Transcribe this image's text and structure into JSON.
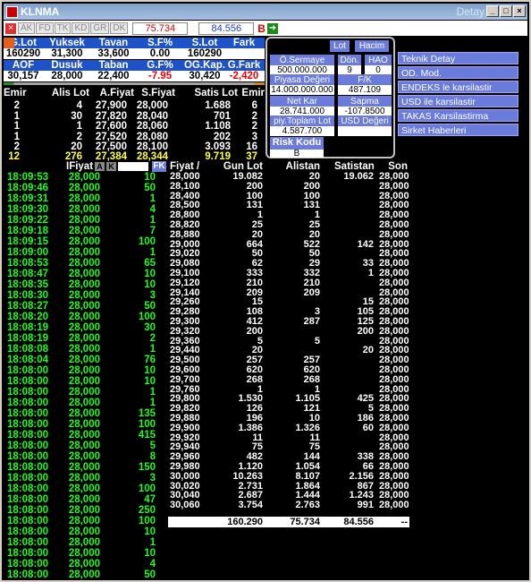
{
  "window": {
    "title": "KLNMA",
    "right_title": "Detay",
    "buttons": [
      "_",
      "□",
      "×"
    ]
  },
  "toolbar": {
    "tabs": [
      "AK",
      "FD",
      "TK",
      "KD",
      "GR",
      "DK"
    ],
    "price": "75.734",
    "price2": "84.556",
    "b_label": "B"
  },
  "summary": {
    "h1": [
      "G.Lot",
      "Yuksek",
      "Tavan",
      "S.F%",
      "S.Lot",
      "Fark"
    ],
    "v1": [
      "160290",
      "31,300",
      "33,600",
      "0.00",
      "160290",
      ""
    ],
    "h2": [
      "AOF",
      "Dusuk",
      "Taban",
      "G.F%",
      "OG.Kap.",
      "G.Fark"
    ],
    "v2": [
      "30,157",
      "28,000",
      "22,400",
      "-7.95",
      "30,420",
      "-2,420"
    ]
  },
  "depth": {
    "headers": [
      "Emir",
      "Alis Lot",
      "A.Fiyat",
      "S.Fiyat",
      "Satis Lot",
      "Emir"
    ],
    "rows": [
      [
        "2",
        "4",
        "27,900",
        "28,000",
        "1.688",
        "6"
      ],
      [
        "1",
        "30",
        "27,820",
        "28,040",
        "701",
        "2"
      ],
      [
        "1",
        "1",
        "27,600",
        "28,060",
        "1.108",
        "2"
      ],
      [
        "1",
        "2",
        "27,520",
        "28,080",
        "202",
        "3"
      ],
      [
        "2",
        "20",
        "27,500",
        "28,100",
        "3.093",
        "16"
      ]
    ],
    "total": [
      "12",
      "276",
      "27,384",
      "28,344",
      "9.719",
      "37"
    ]
  },
  "panel": {
    "lot": "Lot",
    "hacim": "Hacim",
    "o_sermaye": "Ö.Sermaye",
    "o_sermaye_v": "500.000.000",
    "don": "Dön.",
    "don_v": "9",
    "hao": "HAO",
    "hao_v": "0",
    "piyasa": "Piyasa Değeri",
    "piyasa_v": "14.000.000.000",
    "fk": "F/K",
    "fk_v": "487.109",
    "netkar": "Net Kar",
    "netkar_v": "28.741.000",
    "sapma": "Sapma",
    "sapma_v": "-107.8500",
    "ptoplam": "piy.Toplam Lot",
    "ptoplam_v": "4.587.700",
    "usd": "USD Değeri",
    "usd_v": "",
    "risk": "Risk Kodu",
    "risk_v": "B"
  },
  "side_menu": [
    "Teknik Detay",
    "OD. Mod.",
    "ENDEKS le karsilastir",
    "USD ile karsilastir",
    "TAKAS Karsilastirma",
    "Sirket Haberleri"
  ],
  "trades": {
    "header": "IFiyat",
    "a": "A",
    "k": "K",
    "fk": "FK",
    "rows": [
      [
        "18:09:53",
        "28,000",
        "10"
      ],
      [
        "18:09:46",
        "28,000",
        "50"
      ],
      [
        "18:09:31",
        "28,000",
        "1"
      ],
      [
        "18:09:30",
        "28,000",
        "4"
      ],
      [
        "18:09:22",
        "28,000",
        "1"
      ],
      [
        "18:09:18",
        "28,000",
        "7"
      ],
      [
        "18:09:15",
        "28,000",
        "100"
      ],
      [
        "18:09:00",
        "28,000",
        "1"
      ],
      [
        "18:08:53",
        "28,000",
        "65"
      ],
      [
        "18:08:47",
        "28,000",
        "10"
      ],
      [
        "18:08:35",
        "28,000",
        "10"
      ],
      [
        "18:08:30",
        "28,000",
        "3"
      ],
      [
        "18:08:27",
        "28,000",
        "50"
      ],
      [
        "18:08:20",
        "28,000",
        "100"
      ],
      [
        "18:08:19",
        "28,000",
        "30"
      ],
      [
        "18:08:19",
        "28,000",
        "2"
      ],
      [
        "18:08:08",
        "28,000",
        "1"
      ],
      [
        "18:08:04",
        "28,000",
        "76"
      ],
      [
        "18:08:00",
        "28,000",
        "10"
      ],
      [
        "18:08:00",
        "28,000",
        "10"
      ],
      [
        "18:08:00",
        "28,000",
        "1"
      ],
      [
        "18:08:00",
        "28,000",
        "1"
      ],
      [
        "18:08:00",
        "28,000",
        "135"
      ],
      [
        "18:08:00",
        "28,000",
        "100"
      ],
      [
        "18:08:00",
        "28,000",
        "415"
      ],
      [
        "18:08:00",
        "28,000",
        "5"
      ],
      [
        "18:08:00",
        "28,000",
        "8"
      ],
      [
        "18:08:00",
        "28,000",
        "150"
      ],
      [
        "18:08:00",
        "28,000",
        "3"
      ],
      [
        "18:08:00",
        "28,000",
        "100"
      ],
      [
        "18:08:00",
        "28,000",
        "47"
      ],
      [
        "18:08:00",
        "28,000",
        "250"
      ],
      [
        "18:08:00",
        "28,000",
        "100"
      ],
      [
        "18:08:00",
        "28,000",
        "10"
      ],
      [
        "18:08:00",
        "28,000",
        "1"
      ],
      [
        "18:08:00",
        "28,000",
        "10"
      ],
      [
        "18:08:00",
        "28,000",
        "4"
      ],
      [
        "18:08:00",
        "28,000",
        "50"
      ]
    ]
  },
  "levels": {
    "headers": [
      "Fiyat /",
      "Gun Lot",
      "Alistan",
      "Satistan",
      "Son"
    ],
    "rows": [
      [
        "28,000",
        "19.082",
        "20",
        "19.062",
        "28,000"
      ],
      [
        "28,100",
        "200",
        "200",
        "",
        "28,000"
      ],
      [
        "28,400",
        "100",
        "100",
        "",
        "28,000"
      ],
      [
        "28,500",
        "131",
        "131",
        "",
        "28,000"
      ],
      [
        "28,800",
        "1",
        "1",
        "",
        "28,000"
      ],
      [
        "28,820",
        "25",
        "25",
        "",
        "28,000"
      ],
      [
        "28,880",
        "20",
        "20",
        "",
        "28,000"
      ],
      [
        "29,000",
        "664",
        "522",
        "142",
        "28,000"
      ],
      [
        "29,020",
        "50",
        "50",
        "",
        "28,000"
      ],
      [
        "29,080",
        "62",
        "29",
        "33",
        "28,000"
      ],
      [
        "29,100",
        "333",
        "332",
        "1",
        "28,000"
      ],
      [
        "29,120",
        "210",
        "210",
        "",
        "28,000"
      ],
      [
        "29,140",
        "209",
        "209",
        "",
        "28,000"
      ],
      [
        "29,260",
        "15",
        "",
        "15",
        "28,000"
      ],
      [
        "29,280",
        "108",
        "3",
        "105",
        "28,000"
      ],
      [
        "29,300",
        "412",
        "287",
        "125",
        "28,000"
      ],
      [
        "29,320",
        "200",
        "",
        "200",
        "28,000"
      ],
      [
        "29,360",
        "5",
        "5",
        "",
        "28,000"
      ],
      [
        "29,440",
        "20",
        "",
        "20",
        "28,000"
      ],
      [
        "29,500",
        "257",
        "257",
        "",
        "28,000"
      ],
      [
        "29,600",
        "620",
        "620",
        "",
        "28,000"
      ],
      [
        "29,700",
        "268",
        "268",
        "",
        "28,000"
      ],
      [
        "29,760",
        "1",
        "1",
        "",
        "28,000"
      ],
      [
        "29,800",
        "1.530",
        "1.105",
        "425",
        "28,000"
      ],
      [
        "29,820",
        "126",
        "121",
        "5",
        "28,000"
      ],
      [
        "29,880",
        "196",
        "10",
        "186",
        "28,000"
      ],
      [
        "29,900",
        "1.386",
        "1.326",
        "60",
        "28,000"
      ],
      [
        "29,920",
        "11",
        "11",
        "",
        "28,000"
      ],
      [
        "29,940",
        "75",
        "75",
        "",
        "28,000"
      ],
      [
        "29,960",
        "482",
        "144",
        "338",
        "28,000"
      ],
      [
        "29,980",
        "1.120",
        "1.054",
        "66",
        "28,000"
      ],
      [
        "30,000",
        "10.263",
        "8.107",
        "2.156",
        "28,000"
      ],
      [
        "30,020",
        "2.731",
        "1.864",
        "867",
        "28,000"
      ],
      [
        "30,040",
        "2.687",
        "1.444",
        "1.243",
        "28,000"
      ],
      [
        "30,060",
        "3.754",
        "2.763",
        "991",
        "28,000"
      ]
    ],
    "totals": [
      "",
      "160.290",
      "75.734",
      "84.556",
      "--"
    ]
  }
}
